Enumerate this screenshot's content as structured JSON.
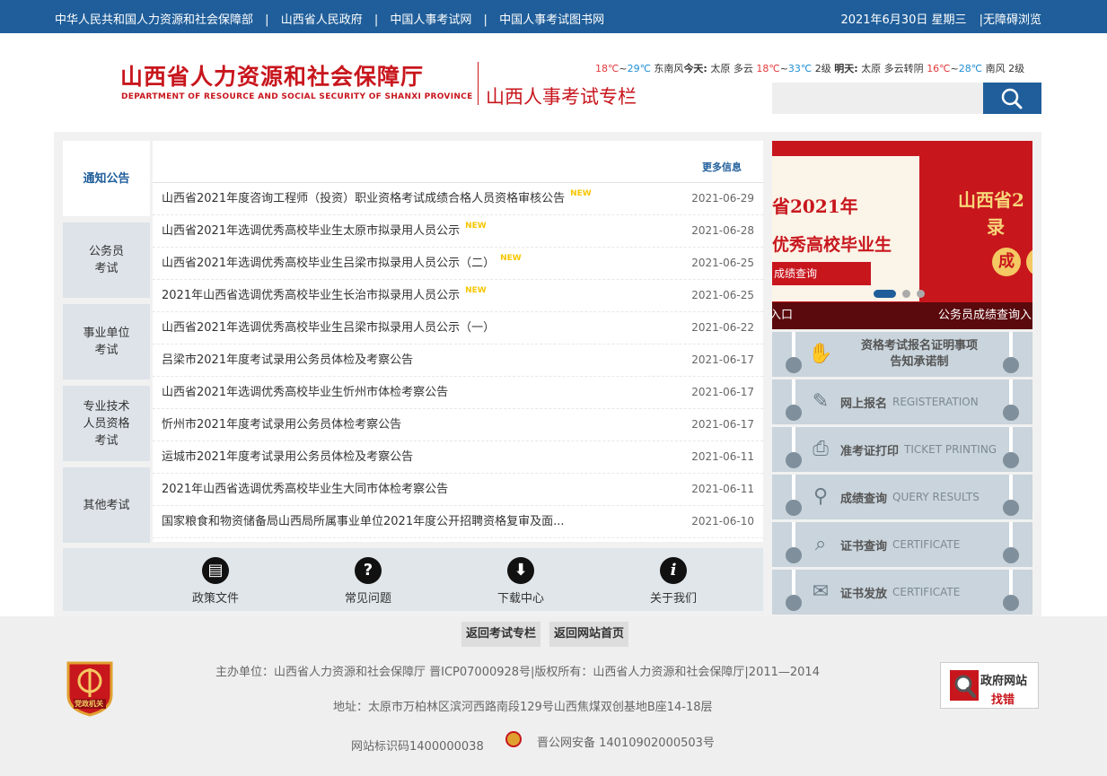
{
  "topbar": {
    "links": [
      "中华人民共和国人力资源和社会保障部",
      "山西省人民政府",
      "中国人事考试网",
      "中国人事考试图书网"
    ],
    "separator": "|",
    "date": "2021年6月30日 星期三",
    "accessible": "|无障碍浏览"
  },
  "header": {
    "logo_cn": "山西省人力资源和社会保障厅",
    "logo_en": "DEPARTMENT OF RESOURCE AND SOCIAL SECURITY OF SHANXI PROVINCE",
    "subtitle": "山西人事考试专栏",
    "weather": {
      "t1": "18℃",
      "t1b": "~",
      "t2": "29℃",
      "w1": " 东南风",
      "today_label": "今天:",
      "today_text": " 太原 多云 ",
      "t3": "18℃",
      "t3b": "~",
      "t4": "33℃",
      "w2": " 2级 ",
      "tomorrow_label": "明天:",
      "tomorrow_text": " 太原 多云转阴 ",
      "t5": "16℃",
      "t5b": "~",
      "t6": "28℃",
      "w3": " 南风 2级"
    },
    "search_placeholder": ""
  },
  "left_tabs": [
    {
      "label": "通知公告",
      "active": true
    },
    {
      "label": "公务员\n考试",
      "active": false
    },
    {
      "label": "事业单位\n考试",
      "active": false
    },
    {
      "label": "专业技术\n人员资格\n考试",
      "active": false
    },
    {
      "label": "其他考试",
      "active": false
    }
  ],
  "news": {
    "more_label": "更多信息",
    "new_badge": "NEW",
    "items": [
      {
        "title": "山西省2021年度咨询工程师（投资）职业资格考试成绩合格人员资格审核公告",
        "date": "2021-06-29",
        "is_new": true
      },
      {
        "title": "山西省2021年选调优秀高校毕业生太原市拟录用人员公示",
        "date": "2021-06-28",
        "is_new": true
      },
      {
        "title": "山西省2021年选调优秀高校毕业生吕梁市拟录用人员公示（二）",
        "date": "2021-06-25",
        "is_new": true
      },
      {
        "title": "2021年山西省选调优秀高校毕业生长治市拟录用人员公示",
        "date": "2021-06-25",
        "is_new": true
      },
      {
        "title": "山西省2021年选调优秀高校毕业生吕梁市拟录用人员公示（一）",
        "date": "2021-06-22",
        "is_new": false
      },
      {
        "title": "吕梁市2021年度考试录用公务员体检及考察公告",
        "date": "2021-06-17",
        "is_new": false
      },
      {
        "title": "山西省2021年选调优秀高校毕业生忻州市体检考察公告",
        "date": "2021-06-17",
        "is_new": false
      },
      {
        "title": "忻州市2021年度考试录用公务员体检考察公告",
        "date": "2021-06-17",
        "is_new": false
      },
      {
        "title": "运城市2021年度考试录用公务员体检及考察公告",
        "date": "2021-06-11",
        "is_new": false
      },
      {
        "title": "2021年山西省选调优秀高校毕业生大同市体检考察公告",
        "date": "2021-06-11",
        "is_new": false
      },
      {
        "title": "国家粮食和物资储备局山西局所属事业单位2021年度公开招聘资格复审及面...",
        "date": "2021-06-10",
        "is_new": false
      }
    ]
  },
  "bottom_icons": [
    {
      "label": "政策文件",
      "icon": "document-icon",
      "glyph": "▤"
    },
    {
      "label": "常见问题",
      "icon": "question-icon",
      "glyph": "?"
    },
    {
      "label": "下载中心",
      "icon": "cloud-download-icon",
      "glyph": "⬇"
    },
    {
      "label": "关于我们",
      "icon": "info-icon",
      "glyph": "i"
    }
  ],
  "banner": {
    "left_line1": "省2021年",
    "left_line2": "优秀高校毕业生",
    "left_line3": "成绩查询",
    "right_line1": "山西省2",
    "right_line2": "录",
    "coin_text": "成",
    "caption_left": "入口",
    "caption_right": "公务员成绩查询入",
    "slide_count": 3,
    "active_slide": 1
  },
  "services": [
    {
      "icon": "handshake-icon",
      "glyph": "🤝",
      "cn": "资格考试报名证明事项\n告知承诺制",
      "en": ""
    },
    {
      "icon": "edit-form-icon",
      "glyph": "✎",
      "cn": "网上报名",
      "en": "REGISTERATION"
    },
    {
      "icon": "printer-icon",
      "glyph": "⎙",
      "cn": "准考证打印",
      "en": "TICKET PRINTING"
    },
    {
      "icon": "user-search-icon",
      "glyph": "⚲",
      "cn": "成绩查询",
      "en": "QUERY RESULTS"
    },
    {
      "icon": "certificate-search-icon",
      "glyph": "⌕",
      "cn": "证书查询",
      "en": "CERTIFICATE"
    },
    {
      "icon": "certificate-issue-icon",
      "glyph": "✉",
      "cn": "证书发放",
      "en": "CERTIFICATE"
    }
  ],
  "footer": {
    "btn_back_exam": "返回考试专栏",
    "btn_back_home": "返回网站首页",
    "line1": "主办单位：山西省人力资源和社会保障厅 晋ICP07000928号|版权所有：山西省人力资源和社会保障厅|2011—2014",
    "line2": "地址：太原市万柏林区滨河西路南段129号山西焦煤双创基地B座14-18层",
    "site_id": "网站标识码1400000038",
    "police": "晋公网安备 14010902000503号",
    "badge_text": "党政机关",
    "jiucuo_a": "政府网站",
    "jiucuo_b": "找错"
  },
  "colors": {
    "primary": "#1f5e9a",
    "brand_red": "#c8161d",
    "tab_bg": "#dde3e9",
    "service_bg": "#c9d4dc"
  }
}
